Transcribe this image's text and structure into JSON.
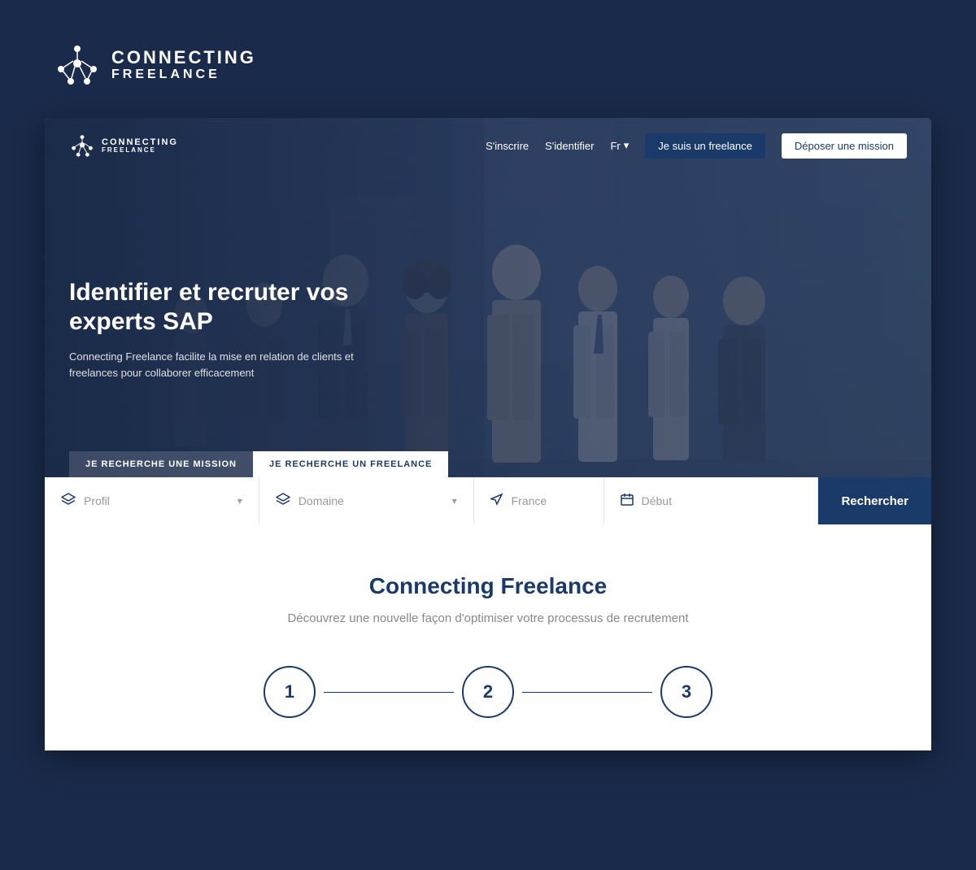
{
  "outer": {
    "logo": {
      "line1": "CONNECTING",
      "line2": "FREELANCE"
    }
  },
  "navbar": {
    "logo": {
      "line1": "CONNECTING",
      "line2": "FREELANCE"
    },
    "links": {
      "signin": "S'inscrire",
      "login": "S'identifier",
      "lang": "Fr"
    },
    "btn_freelance": "Je suis un freelance",
    "btn_mission": "Déposer une mission"
  },
  "hero": {
    "title": "Identifier et recruter vos experts SAP",
    "subtitle": "Connecting Freelance facilite la mise en relation de clients et freelances pour collaborer efficacement"
  },
  "search": {
    "tab1": "JE RECHERCHE UNE MISSION",
    "tab2": "JE RECHERCHE UN FREELANCE",
    "profile_label": "Profil",
    "domain_label": "Domaine",
    "location_label": "France",
    "date_label": "Début",
    "search_btn": "Rechercher"
  },
  "section": {
    "title": "Connecting Freelance",
    "subtitle": "Découvrez une nouvelle façon d'optimiser votre processus de recrutement",
    "steps": [
      "1",
      "2",
      "3"
    ]
  }
}
